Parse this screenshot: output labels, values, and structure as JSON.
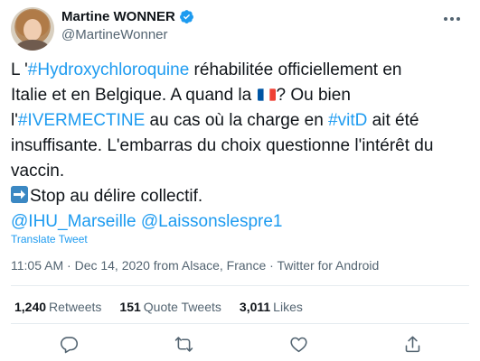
{
  "author": {
    "name": "Martine WONNER",
    "handle": "@MartineWonner"
  },
  "tweet": {
    "line1_prefix": "L '",
    "hashtag1": "#Hydroxychloroquine",
    "line1_suffix": " réhabilitée officiellement en",
    "line2_text": "Italie et en Belgique. A quand la ",
    "line2_after_flag": "? Ou bien",
    "line3_prefix": "l'",
    "hashtag2": "#IVERMECTINE",
    "line3_middle": " au cas où la charge en ",
    "hashtag3": "#vitD",
    "line3_suffix": " ait été",
    "line4_text": "insuffisante. L'embarras du choix questionne l'intérêt du",
    "line5_text": "vaccin.",
    "line6_text": "Stop au délire collectif.",
    "mention1": "@IHU_Marseille",
    "mention2": "@Laissonslespre1"
  },
  "translate_label": "Translate Tweet",
  "meta": {
    "time": "11:05 AM",
    "separator": " · ",
    "date": "Dec 14, 2020",
    "location": " from Alsace, France",
    "source": "Twitter for Android"
  },
  "stats": {
    "retweets_count": "1,240",
    "retweets_label": "Retweets",
    "quotes_count": "151",
    "quotes_label": "Quote Tweets",
    "likes_count": "3,011",
    "likes_label": "Likes"
  },
  "icons": {
    "verified": "verified-badge-icon",
    "more": "more-dots-icon",
    "reply": "reply-icon",
    "retweet": "retweet-icon",
    "like": "like-icon",
    "share": "share-icon",
    "flag": "france-flag-icon",
    "arrow": "right-arrow-emoji-icon"
  },
  "colors": {
    "accent": "#1d9bf0",
    "text": "#0f1419",
    "secondary": "#536471",
    "divider": "#e6ecf0"
  }
}
